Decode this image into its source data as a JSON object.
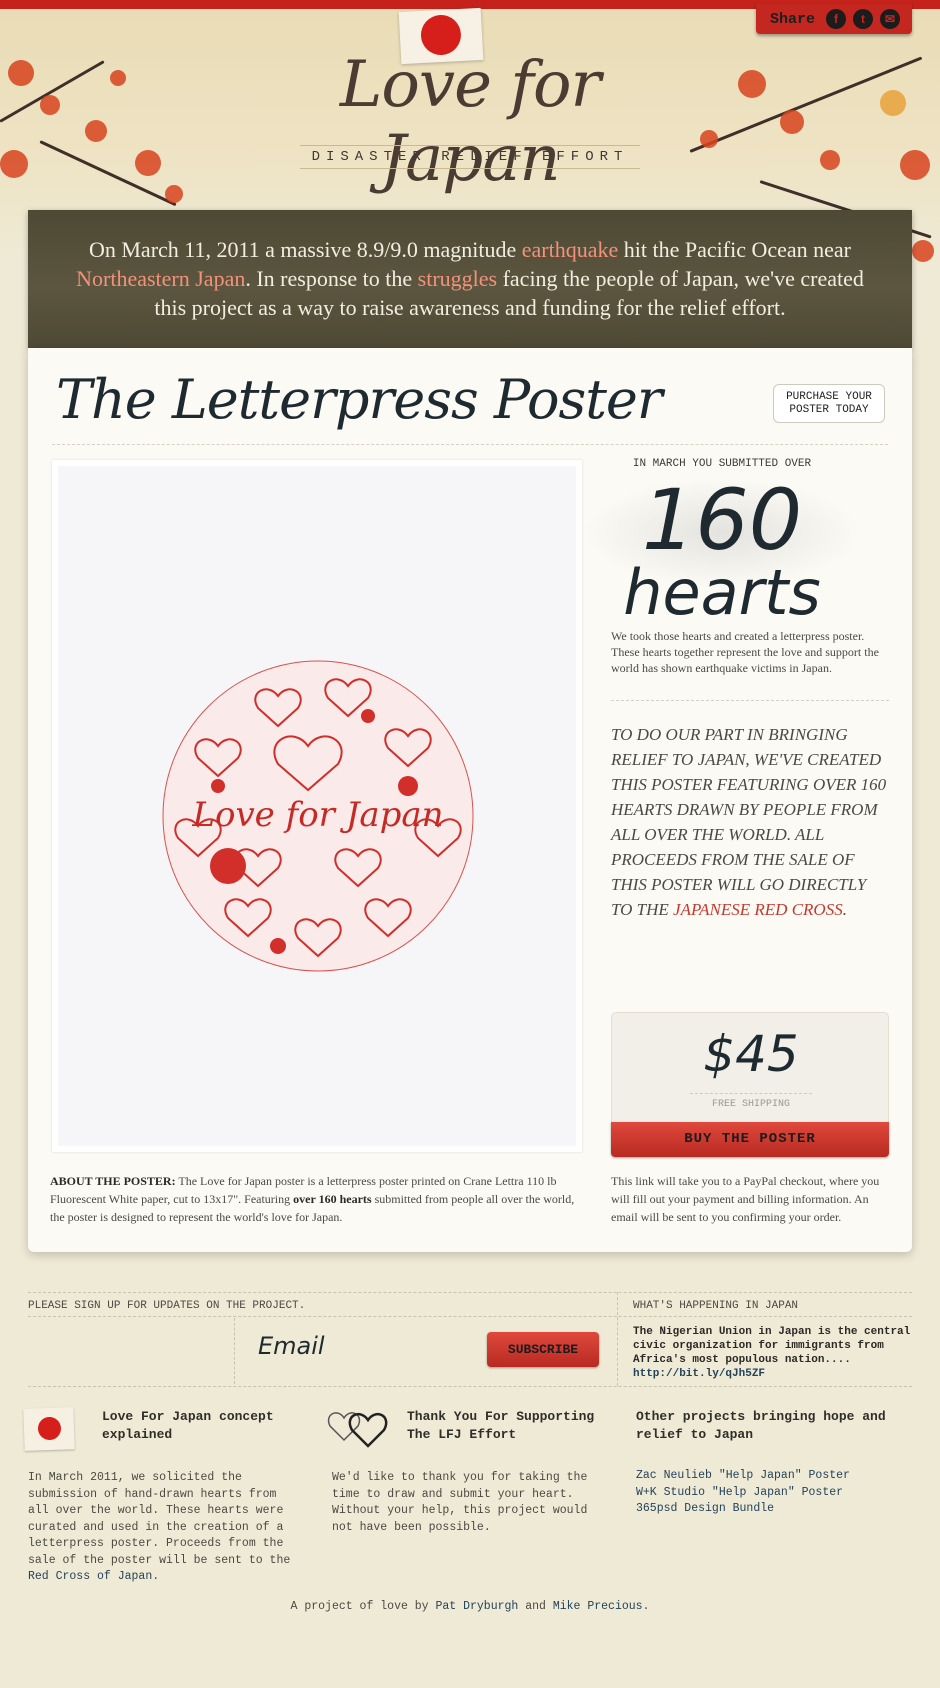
{
  "header": {
    "logo_title": "Love for Japan",
    "logo_subtitle": "DISASTER RELIEF EFFORT",
    "share_label": "Share",
    "social": [
      "f",
      "t",
      "✉"
    ]
  },
  "banner": {
    "part1": "On March 11, 2011 a massive 8.9/9.0 magnitude ",
    "link1": "earthquake",
    "part2": " hit the Pacific Ocean near ",
    "link2": "Northeastern Japan",
    "part3": ". In response to the ",
    "link3": "struggles",
    "part4": " facing the people of Japan, we've created this project as a way to raise awareness and funding for the relief effort."
  },
  "poster": {
    "title": "The Letterpress Poster",
    "purchase_button": "PURCHASE YOUR POSTER TODAY",
    "art_text": "Love for Japan",
    "about_label": "ABOUT THE POSTER:",
    "about_text1": " The Love for Japan poster is a letterpress poster printed on Crane Lettra 110 lb Fluorescent White paper, cut to 13x17\". Featuring ",
    "about_bold": "over 160 hearts",
    "about_text2": " submitted from people all over the world, the poster is designed to represent the world's love for Japan."
  },
  "sidebar": {
    "submitted_label": "IN MARCH YOU SUBMITTED OVER",
    "count": "160",
    "count_unit": "hearts",
    "description": "We took those hearts and created a letterpress poster. These hearts together represent the love and support the world has shown earthquake victims in Japan.",
    "mission_text": "To do our part in bringing relief to Japan, we've created this poster featuring over 160 hearts drawn by people from all over the world. All proceeds from the sale of this poster will go directly to the ",
    "mission_link": "Japanese Red Cross",
    "mission_end": ".",
    "price": "$45",
    "shipping": "FREE SHIPPING",
    "buy_button": "BUY THE POSTER",
    "paypal_note": "This link will take you to a PayPal checkout, where you will fill out your payment and billing information. An email will be sent to you confirming your order."
  },
  "signup": {
    "label": "PLEASE SIGN UP FOR UPDATES ON THE PROJECT.",
    "email_placeholder": "Email",
    "subscribe_button": "SUBSCRIBE"
  },
  "news": {
    "label": "WHAT'S HAPPENING IN JAPAN",
    "text": "The Nigerian Union in Japan is the central civic organization for immigrants from Africa's most populous nation.... ",
    "link": "http://bit.ly/qJh5ZF"
  },
  "columns": {
    "concept_title": "Love For Japan concept explained",
    "concept_text": "In March 2011, we solicited the submission of hand-drawn hearts from all over the world. These hearts were curated and used in the creation of a letterpress poster. Proceeds from the sale of the poster will be sent to the ",
    "concept_link": "Red Cross of Japan",
    "concept_end": ".",
    "thanks_title": "Thank You For Supporting The LFJ Effort",
    "thanks_text": "We'd like to thank you for taking the time to draw and submit your heart. Without your help, this project would not have been possible.",
    "other_title": "Other projects bringing hope and relief to Japan",
    "other_links": [
      "Zac Neulieb \"Help Japan\" Poster",
      "W+K Studio \"Help Japan\" Poster",
      "365psd Design Bundle"
    ]
  },
  "footer": {
    "prefix": "A project of love by ",
    "author1": "Pat Dryburgh",
    "joiner": " and ",
    "author2": "Mike Precious",
    "end": "."
  },
  "colors": {
    "accent_red": "#c4221b",
    "banner_bg": "#545038",
    "link_salmon": "#f39179",
    "link_blue": "#24425a"
  }
}
